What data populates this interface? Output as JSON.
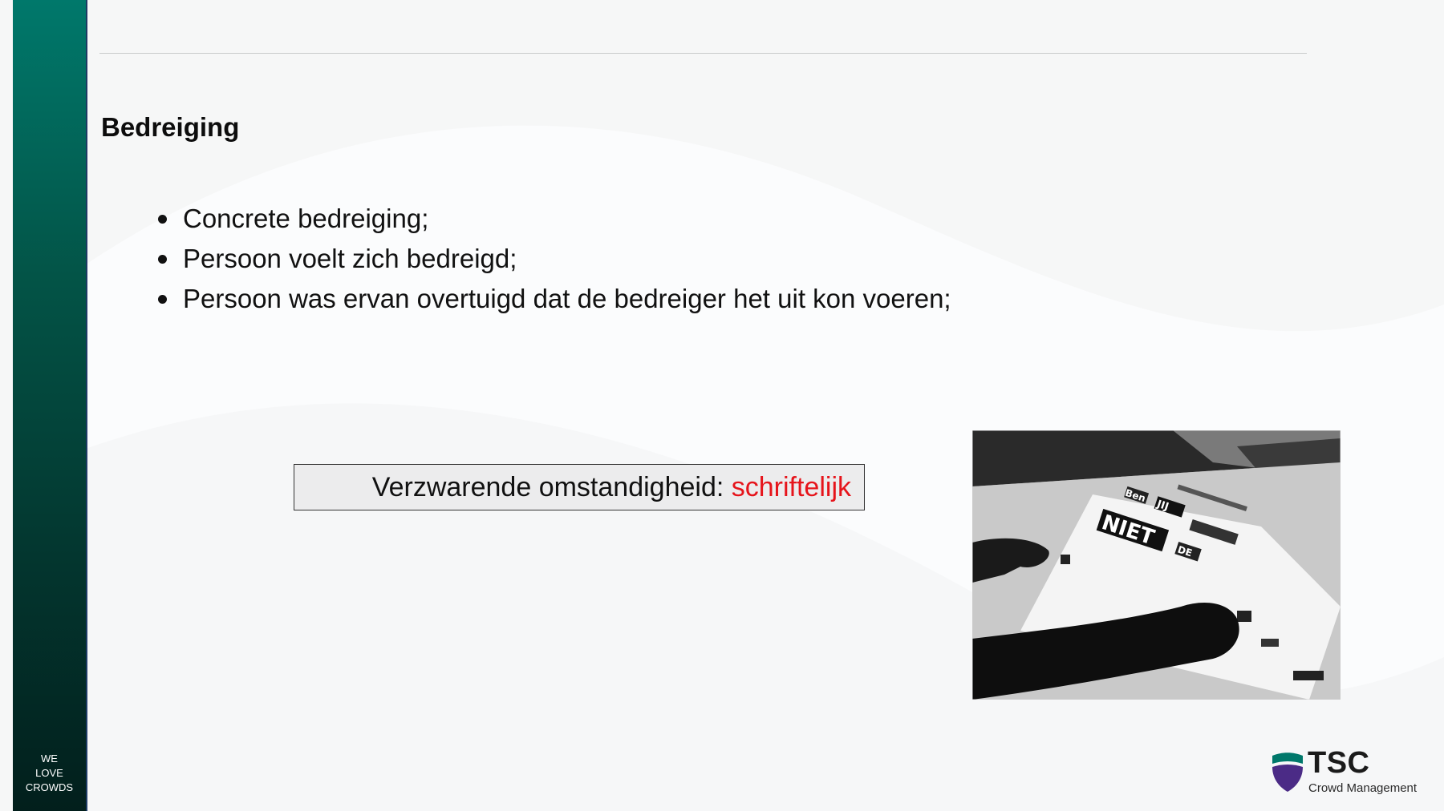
{
  "slide": {
    "title": "Bedreiging",
    "bullets": [
      "Concrete bedreiging;",
      "Persoon voelt zich bedreigd;",
      "Persoon was ervan overtuigd dat de bedreiger het uit kon voeren;"
    ],
    "callout": {
      "label": "Verzwarende omstandigheid: ",
      "value": "schriftelijk",
      "value_color": "#e6141b"
    }
  },
  "sidebar": {
    "slogan": [
      "WE",
      "LOVE",
      "CROWDS"
    ]
  },
  "logo": {
    "brand": "TSC",
    "subtitle": "Crowd Management",
    "shield_colors": [
      "#00786b",
      "#4b2b86"
    ]
  },
  "photo": {
    "letters": [
      "Ben",
      "JIJ",
      "NIET",
      "DE"
    ]
  }
}
